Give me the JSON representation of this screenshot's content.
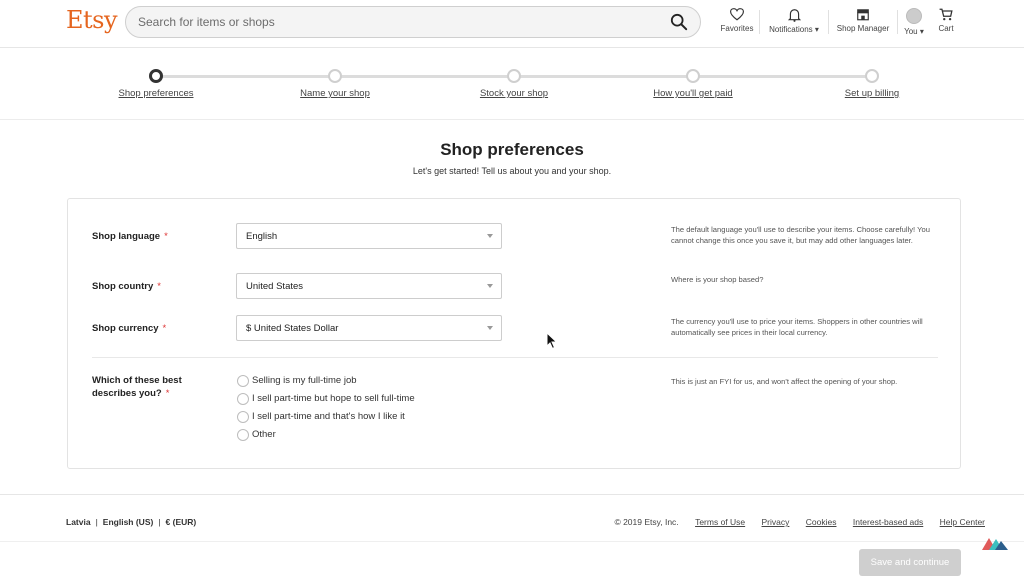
{
  "header": {
    "logo": "Etsy",
    "search_placeholder": "Search for items or shops",
    "nav": {
      "favorites": "Favorites",
      "notifications": "Notifications",
      "shop_manager": "Shop Manager",
      "you": "You",
      "cart": "Cart"
    }
  },
  "stepper": {
    "steps": [
      {
        "label": "Shop preferences",
        "active": true
      },
      {
        "label": "Name your shop",
        "active": false
      },
      {
        "label": "Stock your shop",
        "active": false
      },
      {
        "label": "How you'll get paid",
        "active": false
      },
      {
        "label": "Set up billing",
        "active": false
      }
    ]
  },
  "page": {
    "title": "Shop preferences",
    "subtitle": "Let's get started! Tell us about you and your shop."
  },
  "form": {
    "language": {
      "label": "Shop language",
      "value": "English",
      "help": "The default language you'll use to describe your items. Choose carefully! You cannot change this once you save it, but may add other languages later."
    },
    "country": {
      "label": "Shop country",
      "value": "United States",
      "help": "Where is your shop based?"
    },
    "currency": {
      "label": "Shop currency",
      "value": "$ United States Dollar",
      "help": "The currency you'll use to price your items. Shoppers in other countries will automatically see prices in their local currency."
    },
    "describes": {
      "label_line1": "Which of these best",
      "label_line2": "describes you?",
      "help": "This is just an FYI for us, and won't affect the opening of your shop.",
      "options": [
        "Selling is my full-time job",
        "I sell part-time but hope to sell full-time",
        "I sell part-time and that's how I like it",
        "Other"
      ]
    },
    "required_mark": "*"
  },
  "footer": {
    "region": "Latvia",
    "language": "English (US)",
    "currency": "€ (EUR)",
    "divider": "|",
    "copyright": "© 2019 Etsy, Inc.",
    "links": {
      "terms": "Terms of Use",
      "privacy": "Privacy",
      "cookies": "Cookies",
      "ads": "Interest-based ads",
      "help": "Help Center"
    },
    "save_button": "Save and continue"
  },
  "colors": {
    "brand": "#e5651f",
    "required": "#d33333",
    "disabled_button": "#cfcfcf"
  }
}
